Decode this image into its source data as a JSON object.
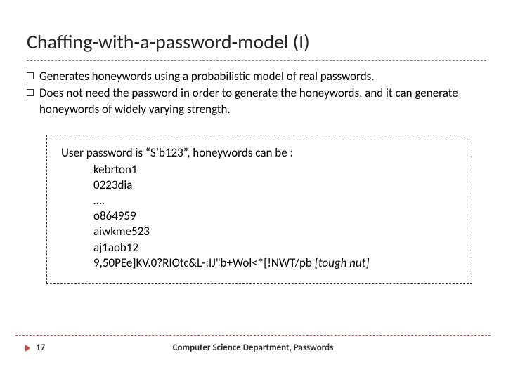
{
  "title": "Chaffing-with-a-password-model (I)",
  "bullets": {
    "b1": "Generates honeywords using a probabilistic model of real passwords.",
    "b2": "Does not need the password in order to generate the honeywords, and it can generate honeywords of widely varying strength."
  },
  "example": {
    "intro": "User password is “S’b123”, honeywords can be :",
    "hw1": "kebrton1",
    "hw2": "0223dia",
    "hw3": "….",
    "hw4": "o864959",
    "hw5": "aiwkme523",
    "hw6": "aj1aob12",
    "hw7_plain": "9,50PEe]KV.0?RIOtc&L-:IJ\"b+Wol<*[!NWT/pb ",
    "hw7_tough": "[tough nut]"
  },
  "footer": {
    "page": "17",
    "center": "Computer Science Department, Passwords"
  }
}
